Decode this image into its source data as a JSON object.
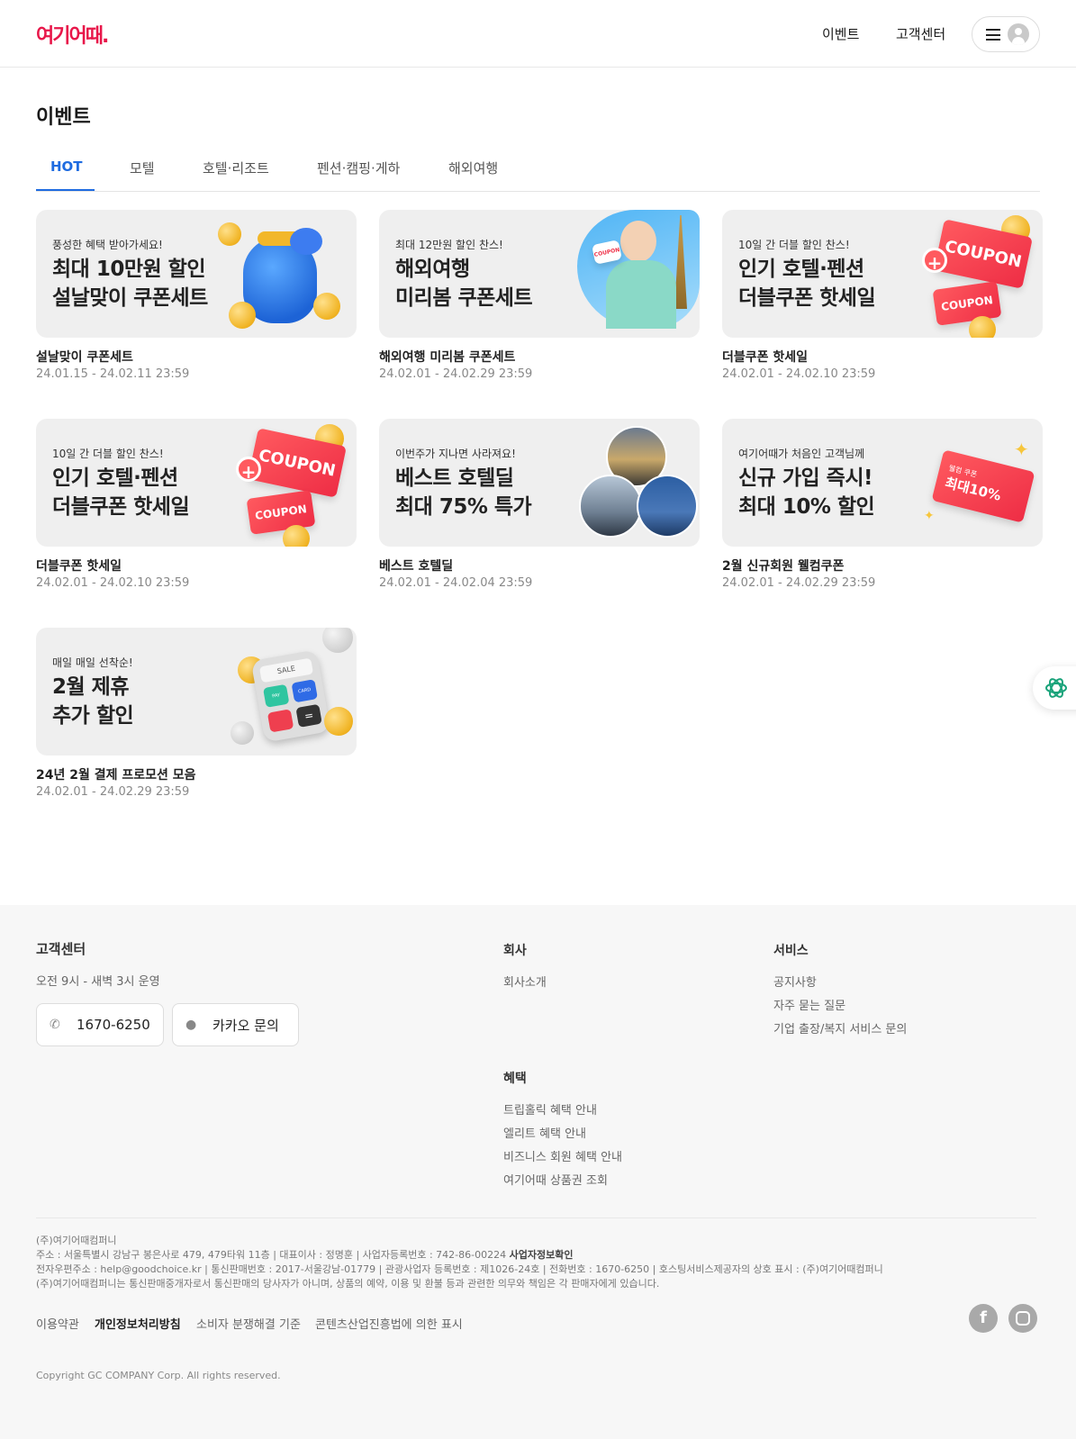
{
  "header": {
    "logo": "여기어때.",
    "nav": [
      "이벤트",
      "고객센터"
    ]
  },
  "page": {
    "title": "이벤트",
    "tabs": [
      "HOT",
      "모텔",
      "호텔·리조트",
      "펜션·캠핑·게하",
      "해외여행"
    ],
    "active_tab": "HOT"
  },
  "events": [
    {
      "sub": "풍성한 혜택 받아가세요!",
      "line1": "최대 10만원 할인",
      "line2": "설날맞이 쿠폰세트",
      "title": "설날맞이 쿠폰세트",
      "period": "24.01.15 - 24.02.11 23:59"
    },
    {
      "sub": "최대 12만원 할인 찬스!",
      "line1": "해외여행",
      "line2": "미리봄 쿠폰세트",
      "title": "해외여행 미리봄 쿠폰세트",
      "period": "24.02.01 - 24.02.29 23:59"
    },
    {
      "sub": "10일 간 더블 할인 찬스!",
      "line1": "인기 호텔·펜션",
      "line2": "더블쿠폰 핫세일",
      "title": "더블쿠폰 핫세일",
      "period": "24.02.01 - 24.02.10 23:59"
    },
    {
      "sub": "10일 간 더블 할인 찬스!",
      "line1": "인기 호텔·펜션",
      "line2": "더블쿠폰 핫세일",
      "title": "더블쿠폰 핫세일",
      "period": "24.02.01 - 24.02.10 23:59"
    },
    {
      "sub": "이번주가 지나면 사라져요!",
      "line1": "베스트 호텔딜",
      "line2": "최대 75% 특가",
      "title": "베스트 호텔딜",
      "period": "24.02.01 - 24.02.04 23:59"
    },
    {
      "sub": "여기어때가 처음인 고객님께",
      "line1": "신규 가입 즉시!",
      "line2": "최대 10% 할인",
      "title": "2월 신규회원 웰컴쿠폰",
      "period": "24.02.01 - 24.02.29 23:59"
    },
    {
      "sub": "매일 매일 선착순!",
      "line1": "2월 제휴",
      "line2": "추가 할인",
      "title": "24년 2월 결제 프로모션 모음",
      "period": "24.02.01 - 24.02.29 23:59"
    }
  ],
  "art_text": {
    "coupon": "COUPON",
    "welcome_coupon_small": "웰컴 쿠폰",
    "welcome_coupon_big": "최대10%",
    "sale": "SALE",
    "pay": "PAY",
    "card": "CARD"
  },
  "colors": {
    "brand": "#e8174a",
    "accent": "#1e6be0"
  },
  "footer": {
    "cs_title": "고객센터",
    "cs_hours": "오전 9시 - 새벽 3시 운영",
    "phone": "1670-6250",
    "kakao": "카카오 문의",
    "company_title": "회사",
    "company_links": [
      "회사소개"
    ],
    "service_title": "서비스",
    "service_links": [
      "공지사항",
      "자주 묻는 질문",
      "기업 출장/복지 서비스 문의"
    ],
    "benefit_title": "혜택",
    "benefit_links": [
      "트립홀릭 혜택 안내",
      "엘리트 혜택 안내",
      "비즈니스 회원 혜택 안내",
      "여기어때 상품권 조회"
    ],
    "legal_company": "(주)여기어때컴퍼니",
    "legal_line1": "주소 : 서울특별시 강남구 봉은사로 479, 479타워 11층 | 대표이사 : 정명훈 | 사업자등록번호 : 742-86-00224",
    "legal_line1_link": "사업자정보확인",
    "legal_line2": "전자우편주소 : help@goodchoice.kr | 통신판매번호 : 2017-서울강남-01779 | 관광사업자 등록번호 : 제1026-24호 | 전화번호 : 1670-6250 | 호스팅서비스제공자의 상호 표시 : (주)여기어때컴퍼니",
    "legal_line3": "(주)여기어때컴퍼니는 통신판매중개자로서 통신판매의 당사자가 아니며, 상품의 예약, 이용 및 환불 등과 관련한 의무와 책임은 각 판매자에게 있습니다.",
    "policies": [
      "이용약관",
      "개인정보처리방침",
      "소비자 분쟁해결 기준",
      "콘텐츠산업진흥법에 의한 표시"
    ],
    "copyright": "Copyright GC COMPANY Corp. All rights reserved."
  }
}
